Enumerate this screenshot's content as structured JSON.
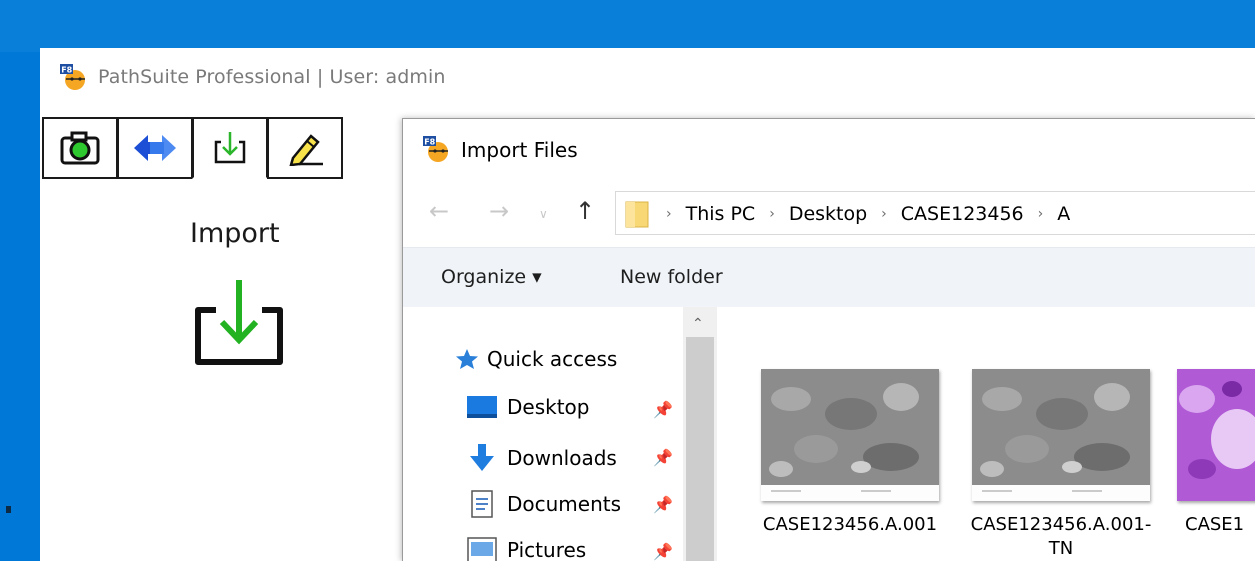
{
  "app": {
    "title": "PathSuite Professional | User: admin",
    "tool_tabs": [
      {
        "name": "capture",
        "icon": "camera-icon"
      },
      {
        "name": "transfer",
        "icon": "transfer-arrows-icon"
      },
      {
        "name": "import",
        "icon": "import-icon",
        "active": true
      },
      {
        "name": "edit",
        "icon": "pencil-icon"
      }
    ],
    "panel_heading": "Import"
  },
  "dialog": {
    "title": "Import Files",
    "breadcrumb": [
      "This PC",
      "Desktop",
      "CASE123456",
      "A"
    ],
    "toolbar": {
      "organize_label": "Organize ▾",
      "new_folder_label": "New folder"
    },
    "nav_items": [
      {
        "label": "Quick access",
        "icon": "star-icon",
        "pinned": false
      },
      {
        "label": "Desktop",
        "icon": "desktop-icon",
        "pinned": true
      },
      {
        "label": "Downloads",
        "icon": "download-arrow-icon",
        "pinned": true
      },
      {
        "label": "Documents",
        "icon": "document-icon",
        "pinned": true
      },
      {
        "label": "Pictures",
        "icon": "pictures-icon",
        "pinned": true
      }
    ],
    "files": [
      {
        "name": "CASE123456.A.001"
      },
      {
        "name": "CASE123456.A.001-TN"
      },
      {
        "name": "CASE1"
      }
    ]
  },
  "colors": {
    "desktop": "#0078d7",
    "toolbar": "#f0f4f9",
    "import_green": "#22b222"
  }
}
